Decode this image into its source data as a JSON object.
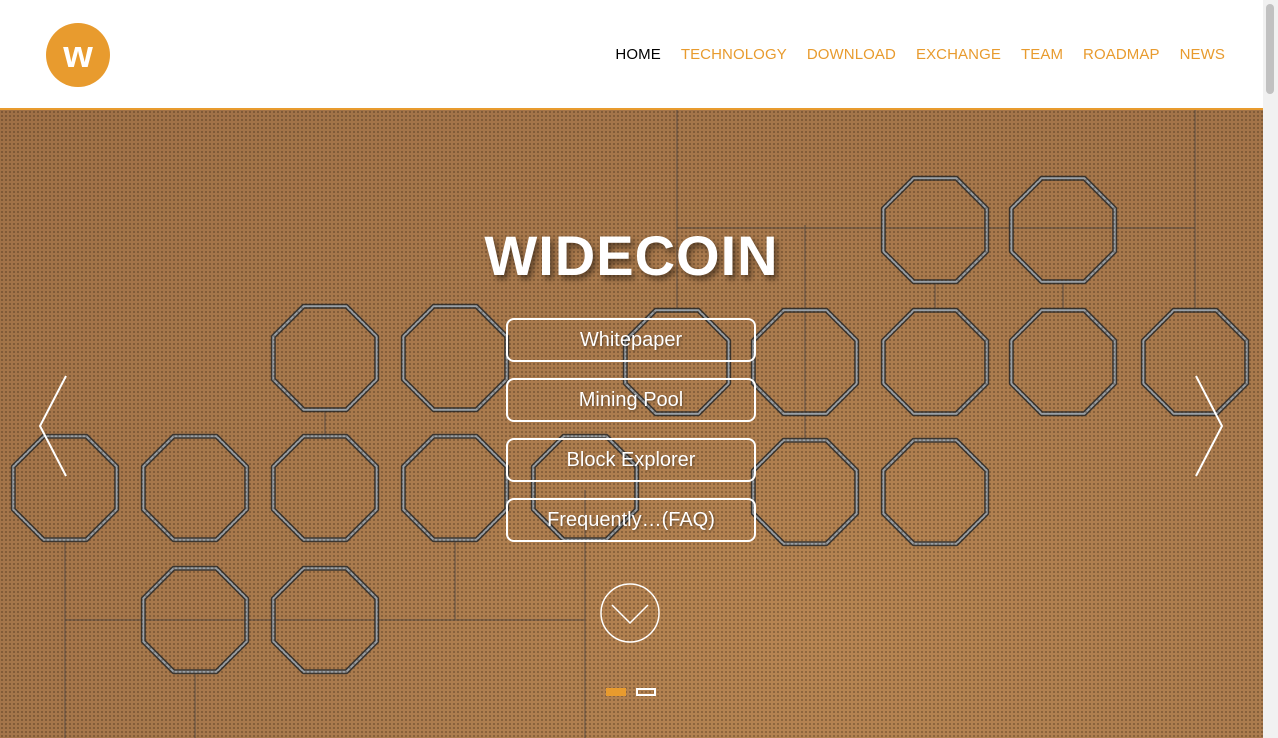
{
  "brand": {
    "logo_letter": "w"
  },
  "nav": {
    "items": [
      {
        "label": "HOME"
      },
      {
        "label": "TECHNOLOGY"
      },
      {
        "label": "DOWNLOAD"
      },
      {
        "label": "EXCHANGE"
      },
      {
        "label": "TEAM"
      },
      {
        "label": "ROADMAP"
      },
      {
        "label": "NEWS"
      }
    ]
  },
  "hero": {
    "title": "WIDECOIN",
    "buttons": [
      {
        "label": "Whitepaper"
      },
      {
        "label": "Mining Pool"
      },
      {
        "label": "Block Explorer"
      },
      {
        "label": "Frequently…(FAQ)"
      }
    ]
  },
  "carousel": {
    "slide_count": 2,
    "active_slide": 1
  },
  "colors": {
    "accent": "#e89b2e",
    "hero_bg": "#a97a4d",
    "text_light": "#ffffff",
    "nav_active": "#000000"
  }
}
